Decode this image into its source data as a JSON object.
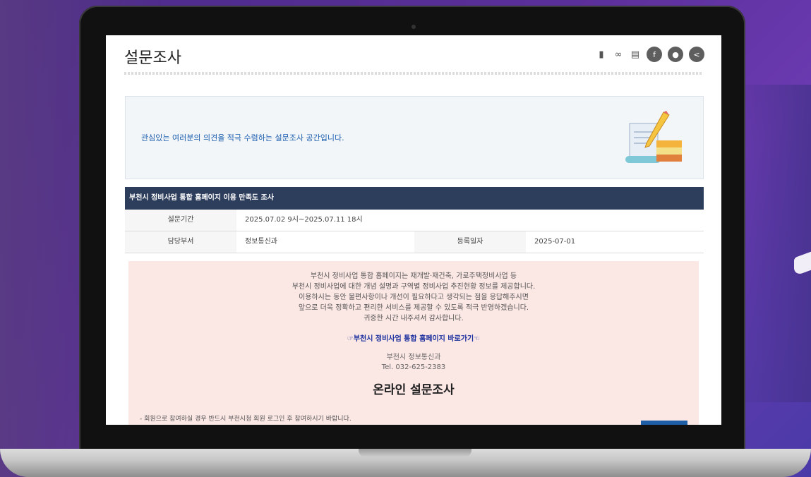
{
  "page": {
    "title": "설문조사",
    "tools": [
      "bookmark-icon",
      "link-icon",
      "print-icon",
      "facebook-icon",
      "kakao-icon",
      "share-icon"
    ]
  },
  "intro": {
    "text": "관심있는 여러분의 의견을 적극 수렴하는 설문조사 공간입니다."
  },
  "survey": {
    "title": "부천시 정비사업 통합 홈페이지 이용 만족도 조사",
    "period_label": "설문기간",
    "period_value": "2025.07.02 9시~2025.07.11 18시",
    "dept_label": "담당부서",
    "dept_value": "정보통신과",
    "date_label": "등록일자",
    "date_value": "2025-07-01"
  },
  "content": {
    "lines": [
      "부천시 정비사업 통합 홈페이지는 재개발·재건축, 가로주택정비사업 등",
      "부천시 정비사업에 대한 개념 설명과 구역별 정비사업 추진현황 정보를 제공합니다.",
      "이용하시는 동안 불편사항이나 개선이 필요하다고 생각되는 점을 응답해주시면",
      "앞으로 더욱 정확하고 편리한 서비스를 제공할 수 있도록 적극 반영하겠습니다.",
      "귀중한 시간 내주셔서 감사합니다."
    ],
    "link": "☞부천시 정비사업 통합 홈페이지 바로가기☜",
    "contact_dept": "부천시 정보통신과",
    "contact_tel": "Tel. 032-625-2383",
    "online_title": "온라인 설문조사",
    "note": "- 회원으로 참여하실 경우 반드시 부천시청 회원 로그인 후 참여하시기 바랍니다."
  }
}
